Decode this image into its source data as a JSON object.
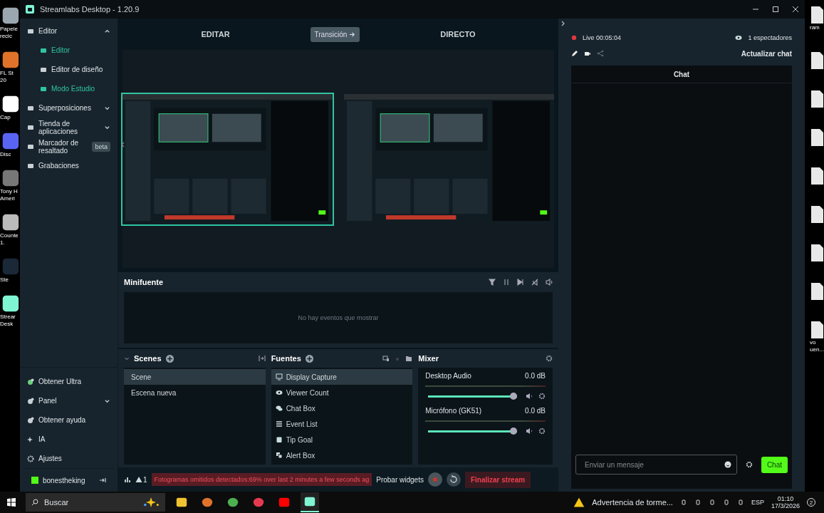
{
  "desktop_left": [
    {
      "lines": [
        "Papele",
        "recic"
      ]
    },
    {
      "lines": [
        "FL St",
        "20"
      ]
    },
    {
      "lines": [
        "Cap"
      ]
    },
    {
      "lines": [
        "Disc"
      ]
    },
    {
      "lines": [
        "Tony H",
        "Ameri"
      ]
    },
    {
      "lines": [
        "Counte",
        "1."
      ]
    },
    {
      "lines": [
        "Ste"
      ]
    },
    {
      "lines": [
        "Strear",
        "Desk"
      ]
    }
  ],
  "desktop_right": [
    {
      "lines": [
        "ram"
      ]
    },
    {
      "lines": [
        "vo",
        "uen..."
      ]
    }
  ],
  "window": {
    "title": "Streamlabs Desktop - 1.20.9"
  },
  "sidebar": {
    "items": [
      {
        "label": "Editor",
        "expanded": true,
        "children": [
          {
            "label": "Editor",
            "selected": true
          },
          {
            "label": "Editor de diseño",
            "selected": false
          },
          {
            "label": "Modo Estudio",
            "selected": true
          }
        ]
      },
      {
        "label": "Superposiciones",
        "expanded": false
      },
      {
        "label": "Tienda de aplicaciones",
        "expanded": false
      },
      {
        "label": "Marcador de resaltado",
        "badge": "beta"
      },
      {
        "label": "Grabaciones"
      }
    ],
    "bottom_items": [
      {
        "label": "Obtener Ultra"
      },
      {
        "label": "Panel",
        "expanded": false
      },
      {
        "label": "Obtener ayuda"
      },
      {
        "label": "IA"
      },
      {
        "label": "Ajustes"
      }
    ],
    "user": "bonestheking"
  },
  "header": {
    "left": "EDITAR",
    "transition": "Transición",
    "right": "DIRECTO"
  },
  "minifeed": {
    "title": "Minifuente",
    "empty": "No hay eventos que mostrar"
  },
  "scenes": {
    "title": "Scenes",
    "items": [
      {
        "label": "Scene",
        "selected": true
      },
      {
        "label": "Escena nueva",
        "selected": false
      }
    ]
  },
  "sources": {
    "title": "Fuentes",
    "items": [
      {
        "label": "Display Capture",
        "kind": "monitor",
        "selected": true
      },
      {
        "label": "Viewer Count",
        "kind": "eye",
        "selected": false
      },
      {
        "label": "Chat Box",
        "kind": "chat",
        "selected": false
      },
      {
        "label": "Event List",
        "kind": "list",
        "selected": false
      },
      {
        "label": "Tip Goal",
        "kind": "goal",
        "selected": false
      },
      {
        "label": "Alert Box",
        "kind": "alert",
        "selected": false
      }
    ]
  },
  "mixer": {
    "title": "Mixer",
    "channels": [
      {
        "name": "Desktop Audio",
        "reading": "0.0 dB",
        "level": 1
      },
      {
        "name": "Micrófono (GK51)",
        "reading": "0.0 dB",
        "level": 1
      }
    ]
  },
  "footer": {
    "alerts": "1",
    "error": "Fotogramas omitidos detectados:69% over last 2 minutes a few seconds ag",
    "test": "Probar widgets",
    "end": "Finalizar stream"
  },
  "chat": {
    "live": "Live 00:05:04",
    "viewers": "1 espectadores",
    "refresh": "Actualizar chat",
    "title": "Chat",
    "placeholder": "Enviar un mensaje",
    "send": "Chat"
  },
  "taskbar": {
    "search": "Buscar",
    "weather": "Advertencia de torme...",
    "lang": "ESP",
    "time": "01:10",
    "date": "17/3/2026",
    "notifications": "2"
  }
}
